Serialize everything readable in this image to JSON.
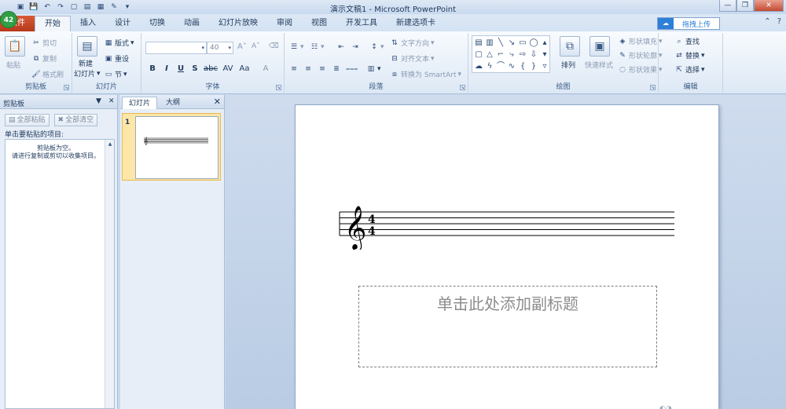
{
  "app": {
    "badge": "42",
    "title": "演示文稿1 - Microsoft PowerPoint"
  },
  "titlebar": {
    "minimize": "—",
    "restore": "❐",
    "close": "✕"
  },
  "tabs": {
    "file": "文件",
    "items": [
      "开始",
      "插入",
      "设计",
      "切换",
      "动画",
      "幻灯片放映",
      "审阅",
      "视图",
      "开发工具",
      "新建选项卡"
    ],
    "upload": "拖拽上传"
  },
  "ribbon": {
    "clipboard": {
      "label": "剪贴板",
      "paste": "粘贴",
      "cut": "剪切",
      "copy": "复制",
      "format_painter": "格式刷"
    },
    "slides": {
      "label": "幻灯片",
      "new_slide_line1": "新建",
      "new_slide_line2": "幻灯片",
      "layout": "版式",
      "reset": "重设",
      "section": "节"
    },
    "font": {
      "label": "字体",
      "font_name": "",
      "font_size": "40",
      "bold": "B",
      "italic": "I",
      "underline": "U",
      "shadow": "S",
      "strike": "abc",
      "spacing": "AV",
      "case": "Aa",
      "color": "A"
    },
    "paragraph": {
      "label": "段落",
      "text_direction": "文字方向",
      "align_text": "对齐文本",
      "smartart": "转换为 SmartArt"
    },
    "drawing": {
      "label": "绘图",
      "arrange": "排列",
      "quick_styles": "快速样式",
      "shape_fill": "形状填充",
      "shape_outline": "形状轮廓",
      "shape_effects": "形状效果"
    },
    "editing": {
      "label": "编辑",
      "find": "查找",
      "replace": "替换",
      "select": "选择"
    }
  },
  "clipboard_pane": {
    "title": "剪贴板",
    "paste_all": "全部粘贴",
    "clear_all": "全部清空",
    "instruction": "单击要粘贴的项目:",
    "empty_line1": "剪贴板为空。",
    "empty_line2": "请进行复制或剪切以收集项目。"
  },
  "slides_pane": {
    "tab_slides": "幻灯片",
    "tab_outline": "大纲",
    "slide_number": "1"
  },
  "slide": {
    "time_signature_top": "4",
    "time_signature_bottom": "4",
    "subtitle_placeholder": "单击此处添加副标题"
  }
}
